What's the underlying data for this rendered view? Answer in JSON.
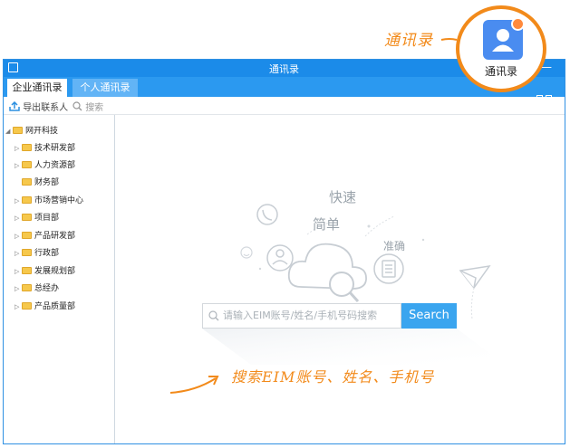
{
  "annotations": {
    "top": "通讯录",
    "bottom": "搜索EIM账号、姓名、手机号"
  },
  "app_badge": {
    "label": "通讯录",
    "icon": "user-icon",
    "color": "#4a8cf0"
  },
  "window": {
    "title": "通讯录",
    "minimize_label": "—"
  },
  "tabs": [
    {
      "label": "企业通讯录"
    },
    {
      "label": "个人通讯录"
    }
  ],
  "toolbar": {
    "export_label": "导出联系人",
    "search_label": "搜索"
  },
  "tree": {
    "root": "网开科技",
    "items": [
      {
        "label": "技术研发部",
        "expandable": true
      },
      {
        "label": "人力资源部",
        "expandable": true
      },
      {
        "label": "财务部",
        "expandable": false
      },
      {
        "label": "市场营销中心",
        "expandable": true
      },
      {
        "label": "项目部",
        "expandable": true
      },
      {
        "label": "产品研发部",
        "expandable": true
      },
      {
        "label": "行政部",
        "expandable": true
      },
      {
        "label": "发展规划部",
        "expandable": true
      },
      {
        "label": "总经办",
        "expandable": true
      },
      {
        "label": "产品质量部",
        "expandable": true
      }
    ]
  },
  "hero": {
    "keyword1": "快速",
    "keyword2": "简单",
    "keyword3": "准确"
  },
  "search": {
    "placeholder": "请输入EIM账号/姓名/手机号码搜索",
    "button_label": "Search"
  },
  "colors": {
    "accent": "#1b8be9",
    "annotation": "#f28a1a",
    "search_button": "#3aa5ef"
  }
}
